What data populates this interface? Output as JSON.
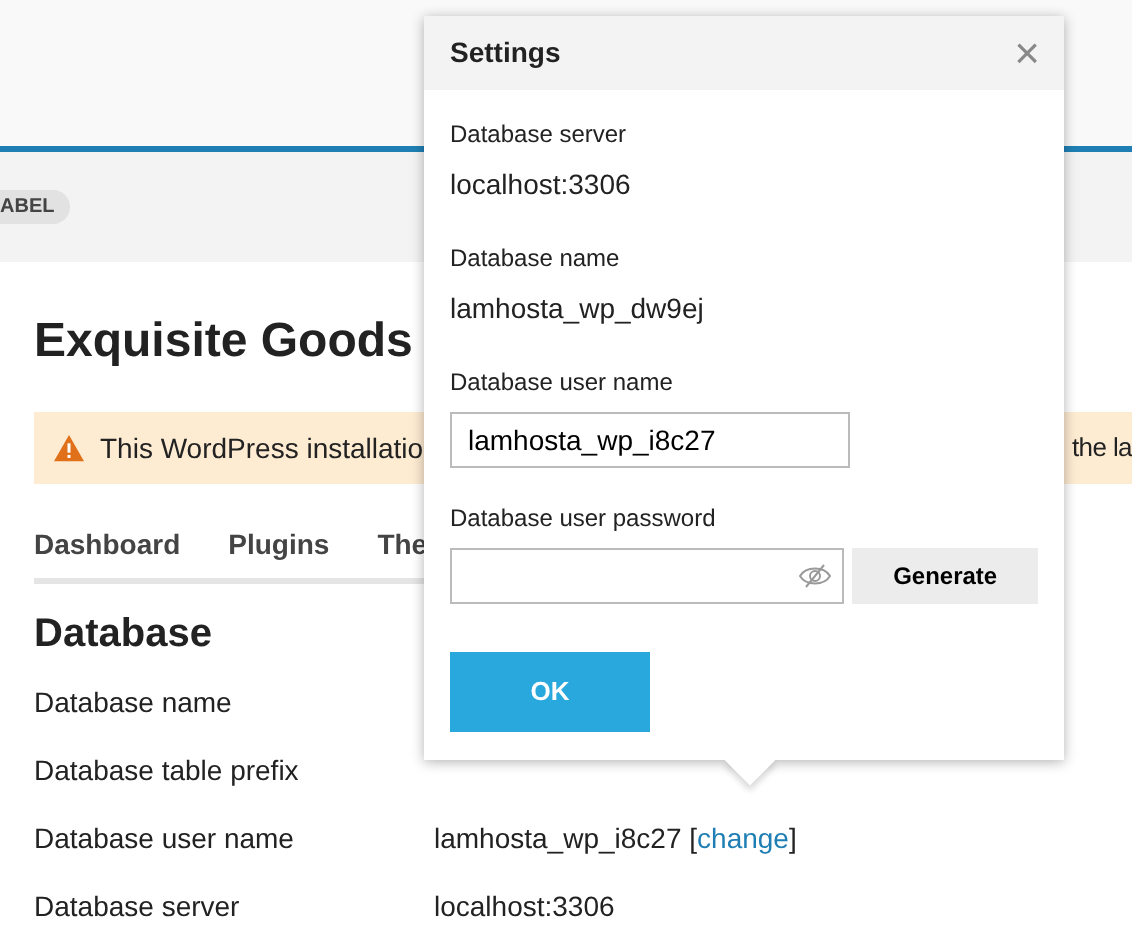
{
  "header_badge": "ABEL",
  "site_title": "Exquisite Goods",
  "warning": {
    "text_left": "This WordPress installatio",
    "text_right": "the la"
  },
  "tabs": [
    {
      "label": "Dashboard",
      "selected": false
    },
    {
      "label": "Plugins",
      "selected": false
    },
    {
      "label": "The",
      "selected": false
    }
  ],
  "section_title": "Database",
  "rows": [
    {
      "label": "Database name"
    },
    {
      "label": "Database table prefix"
    },
    {
      "label": "Database user name",
      "value": "lamhosta_wp_i8c27",
      "bracket_open": "[",
      "link": "change",
      "bracket_close": "]"
    },
    {
      "label": "Database server",
      "value": "localhost:3306"
    }
  ],
  "dialog": {
    "title": "Settings",
    "close": "×",
    "fields": [
      {
        "kind": "static",
        "label": "Database server",
        "value": "localhost:3306"
      },
      {
        "kind": "static",
        "label": "Database name",
        "value": "lamhosta_wp_dw9ej"
      },
      {
        "kind": "text",
        "label": "Database user name",
        "value": "lamhosta_wp_i8c27"
      },
      {
        "kind": "password",
        "label": "Database user password",
        "button": "Generate"
      }
    ],
    "ok": "OK"
  }
}
